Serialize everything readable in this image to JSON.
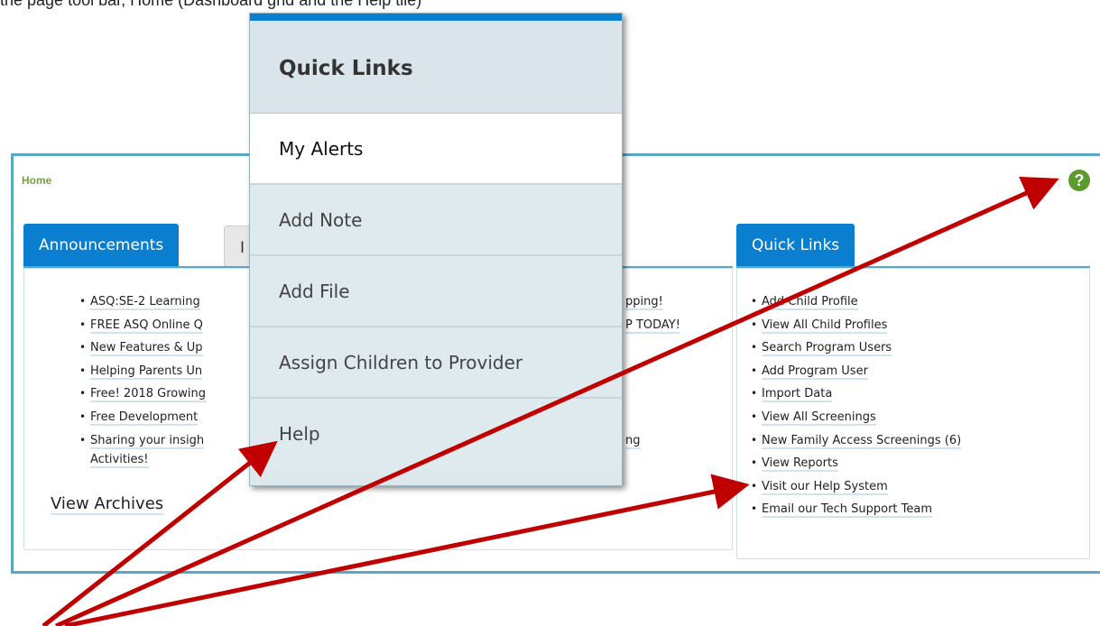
{
  "caption": "the page tool bar, Home (Dashboard grid and the Help tile)",
  "breadcrumb": "Home",
  "help_icon_glyph": "?",
  "announcements": {
    "tab_active": "Announcements",
    "tab_inactive": "I",
    "items": [
      "ASQ:SE-2 Learning",
      "FREE ASQ Online Q",
      "New Features & Up",
      "Helping Parents Un",
      "Free! 2018 Growing",
      "Free Development",
      "Sharing your insigh"
    ],
    "items_right": [
      "pping!",
      "P TODAY!",
      "",
      "",
      "",
      "",
      "ng"
    ],
    "wrap_line": "Activities!",
    "view_archives": "View Archives"
  },
  "quick_links_panel": {
    "tab": "Quick Links",
    "items": [
      "Add Child Profile",
      "View All Child Profiles",
      "Search Program Users",
      "Add Program User",
      "Import Data",
      "View All Screenings",
      "New Family Access Screenings (6)",
      "View Reports",
      "Visit our Help System",
      "Email our Tech Support Team"
    ]
  },
  "popup": {
    "header": "Quick Links",
    "items": [
      "My Alerts",
      "Add Note",
      "Add File",
      "Assign Children to Provider",
      "Help"
    ]
  },
  "colors": {
    "accent_blue": "#0a7fcf",
    "panel_border": "#5aa8c8",
    "arrow_red": "#c00000",
    "help_green": "#5a9a2e"
  },
  "icons": {
    "help": "question-circle-icon"
  }
}
